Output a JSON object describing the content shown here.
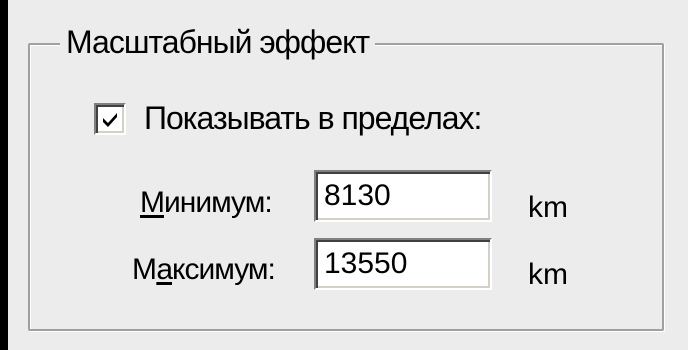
{
  "group": {
    "title": "Масштабный эффект"
  },
  "checkbox": {
    "label": "Показывать в пределах:",
    "checked": true
  },
  "minimum": {
    "label_accel": "М",
    "label_rest": "инимум:",
    "value": "8130",
    "unit": "km"
  },
  "maximum": {
    "label_before": "М",
    "label_accel": "а",
    "label_rest": "ксимум:",
    "value": "13550",
    "unit": "km"
  },
  "colors": {
    "dialog_background": "#ececec",
    "frame_border": "#a0a0a0",
    "input_background": "#ffffff",
    "check_mark": "#000000"
  },
  "icons": {
    "checkbox_mark": "checkmark-icon"
  }
}
